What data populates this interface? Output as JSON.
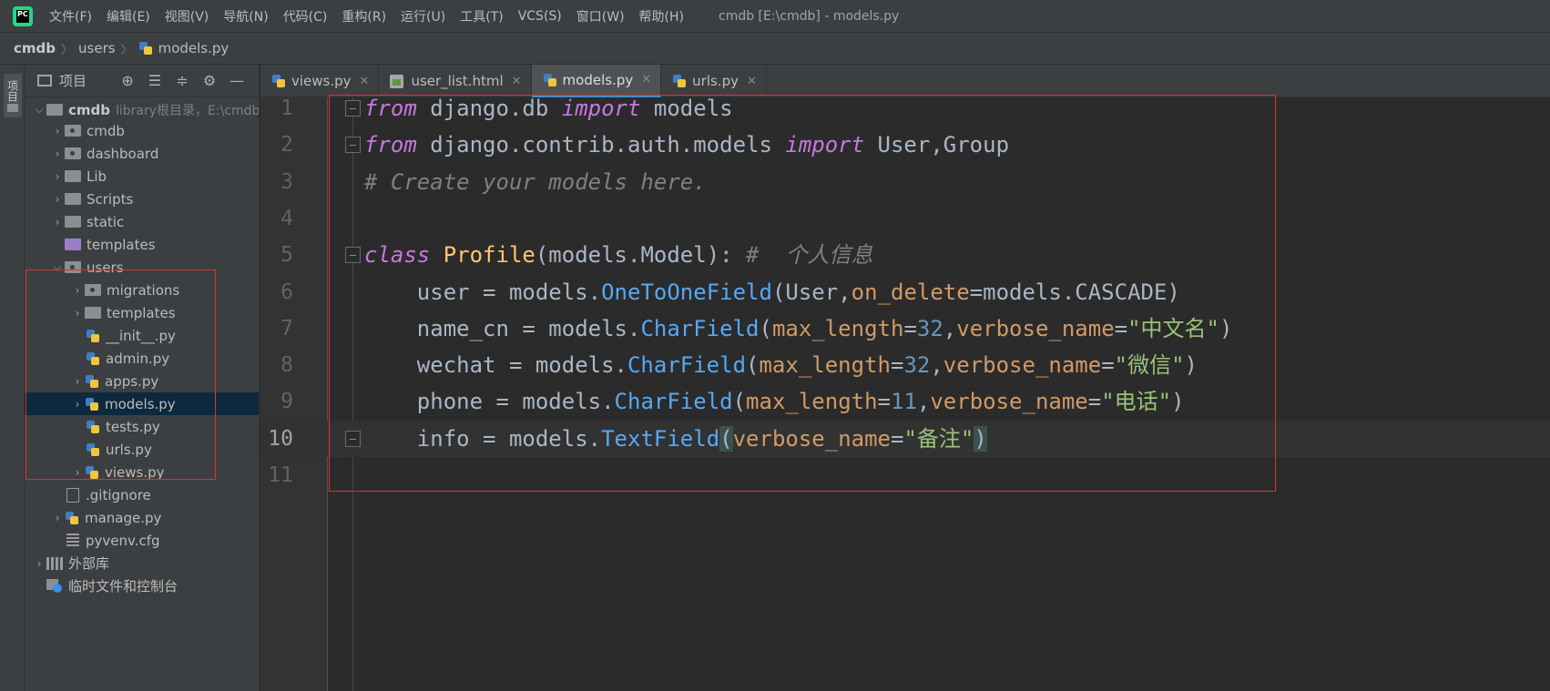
{
  "menubar": {
    "items": [
      "文件(F)",
      "编辑(E)",
      "视图(V)",
      "导航(N)",
      "代码(C)",
      "重构(R)",
      "运行(U)",
      "工具(T)",
      "VCS(S)",
      "窗口(W)",
      "帮助(H)"
    ],
    "window_title": "cmdb [E:\\cmdb] - models.py"
  },
  "breadcrumb": [
    "cmdb",
    "users",
    "models.py"
  ],
  "left_stripe": {
    "label": "项目"
  },
  "project_panel": {
    "title": "项目",
    "tree": [
      {
        "label": "cmdb",
        "hint": "library根目录，E:\\cmdb",
        "bold": true
      },
      {
        "label": "cmdb"
      },
      {
        "label": "dashboard"
      },
      {
        "label": "Lib"
      },
      {
        "label": "Scripts"
      },
      {
        "label": "static"
      },
      {
        "label": "templates"
      },
      {
        "label": "users"
      },
      {
        "label": "migrations"
      },
      {
        "label": "templates"
      },
      {
        "label": "__init__.py"
      },
      {
        "label": "admin.py"
      },
      {
        "label": "apps.py"
      },
      {
        "label": "models.py",
        "selected": true
      },
      {
        "label": "tests.py"
      },
      {
        "label": "urls.py"
      },
      {
        "label": "views.py"
      },
      {
        "label": ".gitignore"
      },
      {
        "label": "manage.py"
      },
      {
        "label": "pyvenv.cfg"
      },
      {
        "label": "外部库"
      },
      {
        "label": "临时文件和控制台"
      }
    ]
  },
  "tabs": [
    {
      "label": "views.py",
      "active": false
    },
    {
      "label": "user_list.html",
      "active": false
    },
    {
      "label": "models.py",
      "active": true
    },
    {
      "label": "urls.py",
      "active": false
    }
  ],
  "editor": {
    "line_numbers": [
      "1",
      "2",
      "3",
      "4",
      "5",
      "6",
      "7",
      "8",
      "9",
      "10",
      "11"
    ],
    "lines": [
      [
        {
          "t": "from",
          "c": "kw2"
        },
        {
          "t": " django.db "
        },
        {
          "t": "import",
          "c": "kw2"
        },
        {
          "t": " models"
        }
      ],
      [
        {
          "t": "from",
          "c": "kw2"
        },
        {
          "t": " django.contrib.auth.models "
        },
        {
          "t": "import",
          "c": "kw2"
        },
        {
          "t": " User,Group"
        }
      ],
      [
        {
          "t": "# Create your models here.",
          "c": "cm"
        }
      ],
      [],
      [
        {
          "t": "class",
          "c": "kw2"
        },
        {
          "t": " "
        },
        {
          "t": "Profile",
          "c": "cls"
        },
        {
          "t": "(models.Model): "
        },
        {
          "t": "#  个人信息",
          "c": "cm"
        }
      ],
      [
        {
          "t": "    user = models."
        },
        {
          "t": "OneToOneField",
          "c": "fn"
        },
        {
          "t": "(User,"
        },
        {
          "t": "on_delete",
          "c": "prm"
        },
        {
          "t": "=models.CASCADE)"
        }
      ],
      [
        {
          "t": "    name_cn = models."
        },
        {
          "t": "CharField",
          "c": "fn"
        },
        {
          "t": "("
        },
        {
          "t": "max_length",
          "c": "prm"
        },
        {
          "t": "="
        },
        {
          "t": "32",
          "c": "num"
        },
        {
          "t": ","
        },
        {
          "t": "verbose_name",
          "c": "prm"
        },
        {
          "t": "="
        },
        {
          "t": "\"中文名\"",
          "c": "str"
        },
        {
          "t": ")"
        }
      ],
      [
        {
          "t": "    wechat = models."
        },
        {
          "t": "CharField",
          "c": "fn"
        },
        {
          "t": "("
        },
        {
          "t": "max_length",
          "c": "prm"
        },
        {
          "t": "="
        },
        {
          "t": "32",
          "c": "num"
        },
        {
          "t": ","
        },
        {
          "t": "verbose_name",
          "c": "prm"
        },
        {
          "t": "="
        },
        {
          "t": "\"微信\"",
          "c": "str"
        },
        {
          "t": ")"
        }
      ],
      [
        {
          "t": "    phone = models."
        },
        {
          "t": "CharField",
          "c": "fn"
        },
        {
          "t": "("
        },
        {
          "t": "max_length",
          "c": "prm"
        },
        {
          "t": "="
        },
        {
          "t": "11",
          "c": "num"
        },
        {
          "t": ","
        },
        {
          "t": "verbose_name",
          "c": "prm"
        },
        {
          "t": "="
        },
        {
          "t": "\"电话\"",
          "c": "str"
        },
        {
          "t": ")"
        }
      ],
      [
        {
          "t": "    info = models."
        },
        {
          "t": "TextField",
          "c": "fn"
        },
        {
          "t": "(",
          "c": "brace"
        },
        {
          "t": "verbose_name",
          "c": "prm"
        },
        {
          "t": "="
        },
        {
          "t": "\"备注\"",
          "c": "str"
        },
        {
          "t": ")",
          "c": "brace"
        }
      ],
      []
    ],
    "current_line": 10
  }
}
